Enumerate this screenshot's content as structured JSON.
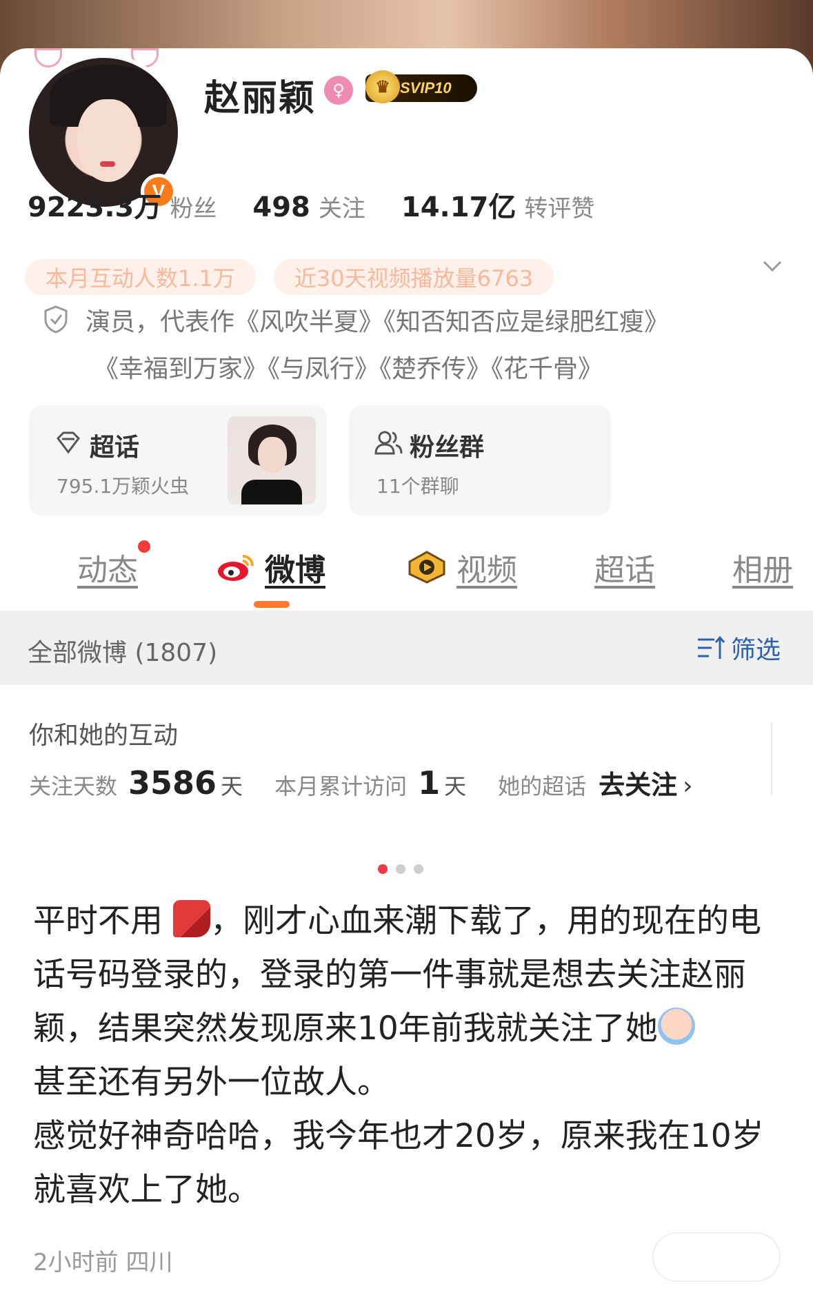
{
  "profile": {
    "name": "赵丽颖",
    "vip_label": "SVIP10",
    "verified_badge": "V",
    "gender_symbol": "♀",
    "stats": [
      {
        "value": "9223.3万",
        "label": "粉丝"
      },
      {
        "value": "498",
        "label": "关注"
      },
      {
        "value": "14.17亿",
        "label": "转评赞"
      }
    ],
    "chips": [
      "本月互动人数1.1万",
      "近30天视频播放量6763"
    ],
    "bio_line1": "演员，代表作《风吹半夏》《知否知否应是绿肥红瘦》",
    "bio_line2": "《幸福到万家》《与凤行》《楚乔传》《花千骨》"
  },
  "cards": {
    "super_topic": {
      "title": "超话",
      "subtitle": "795.1万颖火虫"
    },
    "fan_group": {
      "title": "粉丝群",
      "subtitle": "11个群聊"
    }
  },
  "tabs": [
    {
      "label": "动态",
      "has_dot": true
    },
    {
      "label": "微博",
      "active": true
    },
    {
      "label": "视频"
    },
    {
      "label": "超话"
    },
    {
      "label": "相册"
    }
  ],
  "filter": {
    "all_label": "全部微博 (1807)",
    "filter_label": "筛选"
  },
  "interaction": {
    "title": "你和她的互动",
    "follow_days_label": "关注天数",
    "follow_days_value": "3586",
    "follow_days_unit": "天",
    "visits_label": "本月累计访问",
    "visits_value": "1",
    "visits_unit": "天",
    "super_label": "她的超话",
    "super_action": "去关注",
    "chevron": "›"
  },
  "carousel": {
    "count": 3,
    "active_index": 0
  },
  "post": {
    "part1": "平时不用",
    "part2": "，刚才心血来潮下载了，用的现在的电话号码登录的，登录的第一件事就是想去关注赵丽颖，结果突然发现原来10年前我就关注了她",
    "part3": "甚至还有另外一位故人。\n感觉好神奇哈哈，我今年也才20岁，原来我在10岁就喜欢上了她。",
    "meta": "2小时前  四川"
  },
  "colors": {
    "accent_orange": "#ff7a2f",
    "link_blue": "#2c63a8",
    "chip_text": "#f8b89b",
    "notification_red": "#f23c3c"
  },
  "icons": [
    "chevron-down-icon",
    "shield-icon",
    "super-topic-icon",
    "fan-group-icon",
    "weibo-icon",
    "video-icon",
    "filter-icon",
    "scarf-emoji-icon",
    "crying-emoji-icon"
  ]
}
